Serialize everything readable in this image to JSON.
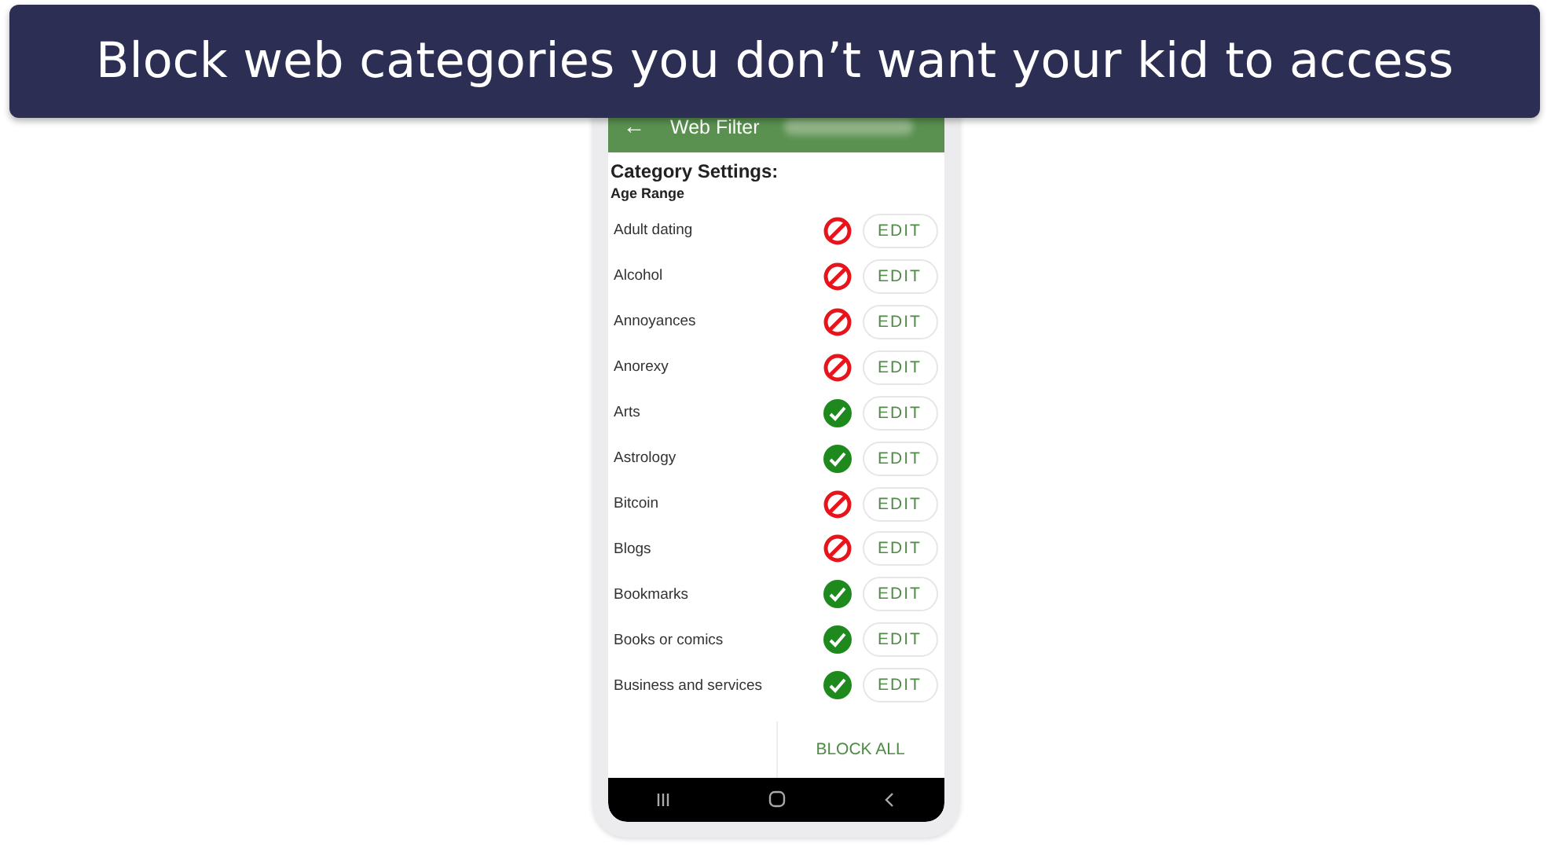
{
  "banner": {
    "title": "Block web categories you don’t want your kid to access"
  },
  "app_bar": {
    "back_icon": "←",
    "title": "Web Filter"
  },
  "section": {
    "title": "Category Settings:",
    "subtitle": "Age Range"
  },
  "categories": [
    {
      "name": "Adult dating",
      "allowed": false,
      "action": "EDIT"
    },
    {
      "name": "Alcohol",
      "allowed": false,
      "action": "EDIT"
    },
    {
      "name": "Annoyances",
      "allowed": false,
      "action": "EDIT"
    },
    {
      "name": "Anorexy",
      "allowed": false,
      "action": "EDIT"
    },
    {
      "name": "Arts",
      "allowed": true,
      "action": "EDIT"
    },
    {
      "name": "Astrology",
      "allowed": true,
      "action": "EDIT"
    },
    {
      "name": "Bitcoin",
      "allowed": false,
      "action": "EDIT"
    },
    {
      "name": "Blogs",
      "allowed": false,
      "action": "EDIT"
    },
    {
      "name": "Bookmarks",
      "allowed": true,
      "action": "EDIT"
    },
    {
      "name": "Books or comics",
      "allowed": true,
      "action": "EDIT"
    },
    {
      "name": "Business and services",
      "allowed": true,
      "action": "EDIT"
    }
  ],
  "footer": {
    "button": "BLOCK ALL"
  }
}
